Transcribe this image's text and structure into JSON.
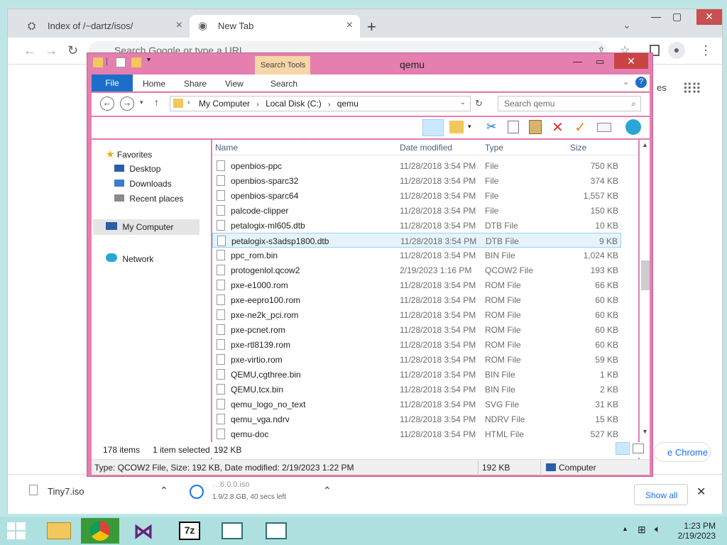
{
  "chrome": {
    "tabs": [
      {
        "label": "Index of /~dartz/isos/",
        "active": false
      },
      {
        "label": "New Tab",
        "active": true
      }
    ],
    "omnibox_placeholder": "Search Google or type a URL",
    "new_tab_partial_text": "es",
    "chrome_button_text": "e Chrome",
    "downloads": [
      {
        "name": "Tiny7.iso",
        "status": ""
      },
      {
        "name": "…6.0.0.iso",
        "status": "1.9/2.8 GB, 40 secs left"
      }
    ],
    "show_all_label": "Show all"
  },
  "explorer": {
    "title": "qemu",
    "context_tab": "Search Tools",
    "ribbon_tabs": [
      "File",
      "Home",
      "Share",
      "View",
      "Search"
    ],
    "breadcrumb": [
      "My Computer",
      "Local Disk (C:)",
      "qemu"
    ],
    "search_placeholder": "Search qemu",
    "nav": {
      "favorites": "Favorites",
      "favorites_items": [
        "Desktop",
        "Downloads",
        "Recent places"
      ],
      "computer": "My Computer",
      "network": "Network"
    },
    "columns": {
      "name": "Name",
      "date": "Date modified",
      "type": "Type",
      "size": "Size"
    },
    "files": [
      {
        "name": "openbios-ppc",
        "date": "11/28/2018 3:54 PM",
        "type": "File",
        "size": "750 KB"
      },
      {
        "name": "openbios-sparc32",
        "date": "11/28/2018 3:54 PM",
        "type": "File",
        "size": "374 KB"
      },
      {
        "name": "openbios-sparc64",
        "date": "11/28/2018 3:54 PM",
        "type": "File",
        "size": "1,557 KB"
      },
      {
        "name": "palcode-clipper",
        "date": "11/28/2018 3:54 PM",
        "type": "File",
        "size": "150 KB"
      },
      {
        "name": "petalogix-ml605.dtb",
        "date": "11/28/2018 3:54 PM",
        "type": "DTB File",
        "size": "10 KB"
      },
      {
        "name": "petalogix-s3adsp1800.dtb",
        "date": "11/28/2018 3:54 PM",
        "type": "DTB File",
        "size": "9 KB",
        "selected": true
      },
      {
        "name": "ppc_rom.bin",
        "date": "11/28/2018 3:54 PM",
        "type": "BIN File",
        "size": "1,024 KB"
      },
      {
        "name": "protogenlol.qcow2",
        "date": "2/19/2023 1:16 PM",
        "type": "QCOW2 File",
        "size": "193 KB"
      },
      {
        "name": "pxe-e1000.rom",
        "date": "11/28/2018 3:54 PM",
        "type": "ROM File",
        "size": "66 KB"
      },
      {
        "name": "pxe-eepro100.rom",
        "date": "11/28/2018 3:54 PM",
        "type": "ROM File",
        "size": "60 KB"
      },
      {
        "name": "pxe-ne2k_pci.rom",
        "date": "11/28/2018 3:54 PM",
        "type": "ROM File",
        "size": "60 KB"
      },
      {
        "name": "pxe-pcnet.rom",
        "date": "11/28/2018 3:54 PM",
        "type": "ROM File",
        "size": "60 KB"
      },
      {
        "name": "pxe-rtl8139.rom",
        "date": "11/28/2018 3:54 PM",
        "type": "ROM File",
        "size": "60 KB"
      },
      {
        "name": "pxe-virtio.rom",
        "date": "11/28/2018 3:54 PM",
        "type": "ROM File",
        "size": "59 KB"
      },
      {
        "name": "QEMU,cgthree.bin",
        "date": "11/28/2018 3:54 PM",
        "type": "BIN File",
        "size": "1 KB"
      },
      {
        "name": "QEMU,tcx.bin",
        "date": "11/28/2018 3:54 PM",
        "type": "BIN File",
        "size": "2 KB"
      },
      {
        "name": "qemu_logo_no_text",
        "date": "11/28/2018 3:54 PM",
        "type": "SVG File",
        "size": "31 KB"
      },
      {
        "name": "qemu_vga.ndrv",
        "date": "11/28/2018 3:54 PM",
        "type": "NDRV File",
        "size": "15 KB"
      },
      {
        "name": "qemu-doc",
        "date": "11/28/2018 3:54 PM",
        "type": "HTML File",
        "size": "527 KB"
      }
    ],
    "status": {
      "items": "178 items",
      "selected": "1 item selected",
      "selected_size": "192 KB",
      "details": "Type: QCOW2 File, Size: 192 KB, Date modified: 2/19/2023 1:22 PM",
      "size2": "192 KB",
      "location": "Computer"
    }
  },
  "taskbar": {
    "time": "1:23 PM",
    "date": "2/19/2023"
  },
  "colors": {
    "explorer_frame": "#e57fb0",
    "file_tab": "#1c6fc9",
    "close_button": "#c94545",
    "desktop": "#bfe6e6"
  }
}
